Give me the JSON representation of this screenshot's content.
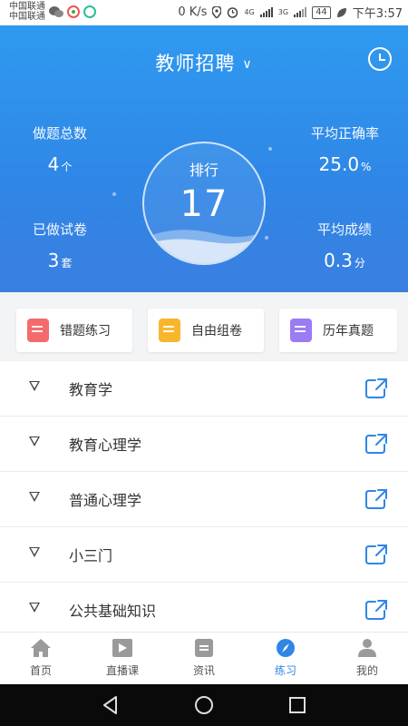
{
  "status_bar": {
    "carrier_1": "中国联通",
    "carrier_2": "中国联通",
    "net_speed": "0 K/s",
    "net_4g": "4G",
    "net_3g": "3G",
    "battery": "44",
    "time": "下午3:57"
  },
  "header": {
    "title": "教师招聘",
    "stats": {
      "total_questions_label": "做题总数",
      "total_questions_value": "4",
      "total_questions_unit": "个",
      "accuracy_label": "平均正确率",
      "accuracy_value": "25.0",
      "accuracy_unit": "%",
      "papers_label": "已做试卷",
      "papers_value": "3",
      "papers_unit": "套",
      "avg_score_label": "平均成绩",
      "avg_score_value": "0.3",
      "avg_score_unit": "分"
    },
    "rank_label": "排行",
    "rank_value": "17",
    "colors": {
      "gradient_top": "#2f9af0",
      "gradient_bottom": "#3a7fe0"
    }
  },
  "quick_actions": [
    {
      "label": "错题练习",
      "icon": "edit-note-icon",
      "color": "#f36b6b"
    },
    {
      "label": "自由组卷",
      "icon": "document-stack-icon",
      "color": "#f8b62d"
    },
    {
      "label": "历年真题",
      "icon": "clipboard-icon",
      "color": "#9b7cf2"
    }
  ],
  "subjects": [
    {
      "name": "教育学"
    },
    {
      "name": "教育心理学"
    },
    {
      "name": "普通心理学"
    },
    {
      "name": "小三门"
    },
    {
      "name": "公共基础知识"
    }
  ],
  "tabbar": {
    "items": [
      {
        "label": "首页",
        "icon": "home-icon"
      },
      {
        "label": "直播课",
        "icon": "live-icon"
      },
      {
        "label": "资讯",
        "icon": "news-icon"
      },
      {
        "label": "练习",
        "icon": "compass-icon"
      },
      {
        "label": "我的",
        "icon": "user-icon"
      }
    ],
    "active_index": 3,
    "accent": "#2f86e6"
  }
}
